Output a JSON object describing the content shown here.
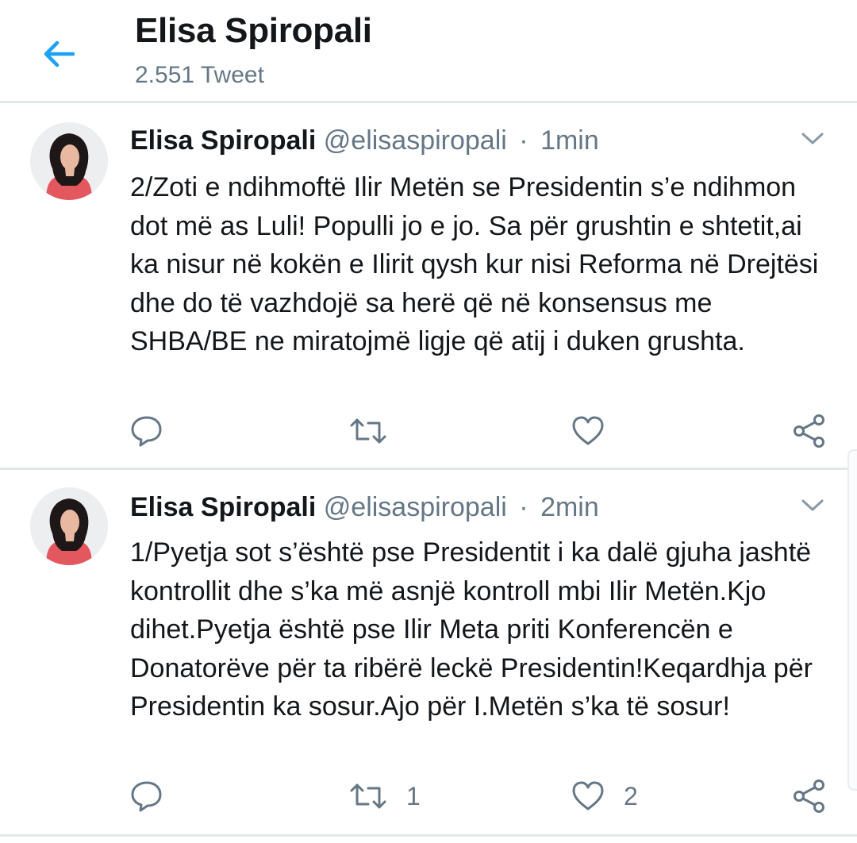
{
  "header": {
    "title": "Elisa Spiropali",
    "subtitle": "2.551 Tweet"
  },
  "tweets": [
    {
      "name": "Elisa Spiropali",
      "handle": "@elisaspiropali",
      "separator": "·",
      "time": "1min",
      "text": "2/Zoti e ndihmoftë Ilir Metën se Presidentin s’e ndihmon dot më as Luli! Populli jo e jo. Sa për grushtin e shtetit,ai ka nisur në kokën e Ilirit qysh kur nisi Reforma në Drejtësi dhe do të vazhdojë sa herë që në konsensus me SHBA/BE ne miratojmë ligje që atij i duken grushta.",
      "retweets": "",
      "likes": ""
    },
    {
      "name": "Elisa Spiropali",
      "handle": "@elisaspiropali",
      "separator": "·",
      "time": "2min",
      "text": "1/Pyetja sot s’është pse Presidentit i ka dalë gjuha jashtë kontrollit dhe s’ka më asnjë kontroll mbi Ilir Metën.Kjo dihet.Pyetja është pse Ilir Meta priti Konferencën e Donatorëve për ta ribërë leckë Presidentin!Keqardhja për Presidentin ka sosur.Ajo për I.Metën s’ka të sosur!",
      "retweets": "1",
      "likes": "2"
    }
  ],
  "icons": {
    "back": "arrow-left-icon",
    "caret": "chevron-down-icon",
    "reply": "reply-icon",
    "retweet": "retweet-icon",
    "like": "heart-icon",
    "share": "share-icon"
  },
  "colors": {
    "accent": "#1da1f2",
    "text": "#14171a",
    "secondary": "#657786",
    "divider": "#e1e8ed"
  }
}
